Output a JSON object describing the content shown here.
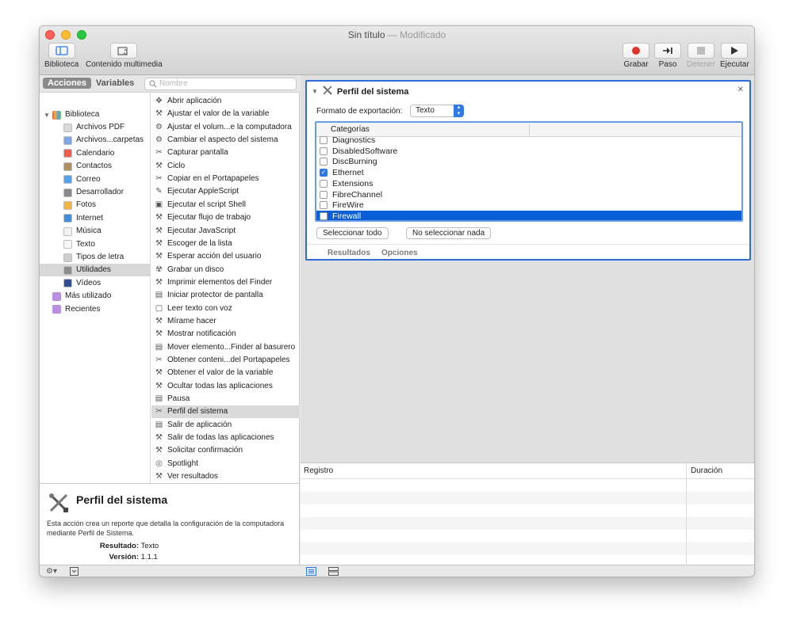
{
  "window": {
    "title": "Sin título",
    "separator": " — ",
    "status": "Modificado"
  },
  "toolbar": {
    "left": [
      {
        "id": "biblioteca",
        "label": "Biblioteca",
        "icon": "sidebar-icon"
      },
      {
        "id": "multimedia",
        "label": "Contenido multimedia",
        "icon": "media-icon"
      }
    ],
    "right": [
      {
        "id": "grabar",
        "label": "Grabar",
        "icon": "record-icon",
        "enabled": true
      },
      {
        "id": "paso",
        "label": "Paso",
        "icon": "step-icon",
        "enabled": true
      },
      {
        "id": "detener",
        "label": "Detener",
        "icon": "stop-icon",
        "enabled": false
      },
      {
        "id": "ejecutar",
        "label": "Ejecutar",
        "icon": "play-icon",
        "enabled": true
      }
    ]
  },
  "library": {
    "tabs": [
      {
        "label": "Acciones",
        "active": true
      },
      {
        "label": "Variables",
        "active": false
      }
    ],
    "search_placeholder": "Nombre",
    "root_label": "Biblioteca",
    "categories": [
      {
        "label": "Archivos PDF",
        "color": "#d9d9d9"
      },
      {
        "label": "Archivos...carpetas",
        "color": "#7da7e8"
      },
      {
        "label": "Calendario",
        "color": "#f25c4c"
      },
      {
        "label": "Contactos",
        "color": "#b08e60"
      },
      {
        "label": "Correo",
        "color": "#4fa3ee"
      },
      {
        "label": "Desarrollador",
        "color": "#888888"
      },
      {
        "label": "Fotos",
        "color": "#f4b43c"
      },
      {
        "label": "Internet",
        "color": "#3e8ee0"
      },
      {
        "label": "Música",
        "color": "#f2f2f2"
      },
      {
        "label": "Texto",
        "color": "#f7f7f7"
      },
      {
        "label": "Tipos de letra",
        "color": "#cfcfcf"
      },
      {
        "label": "Utilidades",
        "color": "#8c8c8c",
        "selected": true
      },
      {
        "label": "Vídeos",
        "color": "#2d4f9a"
      }
    ],
    "smart_groups": [
      {
        "label": "Más utilizado",
        "color": "#b98fe0"
      },
      {
        "label": "Recientes",
        "color": "#b98fe0"
      }
    ],
    "actions": [
      "Abrir aplicación",
      "Ajustar el valor de la variable",
      "Ajustar el volum...e la computadora",
      "Cambiar el aspecto del sistema",
      "Capturar pantalla",
      "Ciclo",
      "Copiar en el Portapapeles",
      "Ejecutar AppleScript",
      "Ejecutar el script Shell",
      "Ejecutar flujo de trabajo",
      "Ejecutar JavaScript",
      "Escoger de la lista",
      "Esperar acción del usuario",
      "Grabar un disco",
      "Imprimir elementos del Finder",
      "Iniciar protector de pantalla",
      "Leer texto con voz",
      "Mírame hacer",
      "Mostrar notificación",
      "Mover elemento...Finder al basurero",
      "Obtener conteni...del Portapapeles",
      "Obtener el valor de la variable",
      "Ocultar todas las aplicaciones",
      "Pausa",
      "Perfil del sistema",
      "Salir de aplicación",
      "Salir de todas las aplicaciones",
      "Solicitar confirmación",
      "Spotlight",
      "Ver resultados"
    ],
    "selected_action": "Perfil del sistema"
  },
  "description": {
    "title": "Perfil del sistema",
    "text": "Esta acción crea un reporte que detalla la configuración de la computadora mediante Perfil de Sistema.",
    "result_label": "Resultado:",
    "result_value": "Texto",
    "version_label": "Versión:",
    "version_value": "1.1.1"
  },
  "action_card": {
    "title": "Perfil del sistema",
    "format_label": "Formato de exportación:",
    "format_value": "Texto",
    "column_header": "Categorías",
    "rows": [
      {
        "label": "Diagnostics",
        "checked": false
      },
      {
        "label": "DisabledSoftware",
        "checked": false
      },
      {
        "label": "DiscBurning",
        "checked": false
      },
      {
        "label": "Ethernet",
        "checked": true
      },
      {
        "label": "Extensions",
        "checked": false
      },
      {
        "label": "FibreChannel",
        "checked": false
      },
      {
        "label": "FireWire",
        "checked": false
      },
      {
        "label": "Firewall",
        "checked": false,
        "selected": true
      }
    ],
    "select_all": "Seleccionar todo",
    "select_none": "No seleccionar nada",
    "footer_tabs": [
      "Resultados",
      "Opciones"
    ]
  },
  "log": {
    "col_registro": "Registro",
    "col_duracion": "Duración"
  },
  "colors": {
    "accent": "#2f79e6",
    "selection": "#0b5fd6",
    "card_border": "#2f6ad8"
  }
}
